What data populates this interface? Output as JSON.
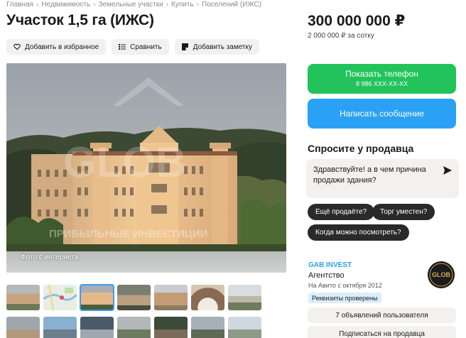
{
  "breadcrumbs": [
    "Главная",
    "Недвижимость",
    "Земельные участки",
    "Купить",
    "Поселений (ИЖС)"
  ],
  "listing": {
    "title": "Участок 1,5 га (ИЖС)",
    "price": "300 000 000 ₽",
    "price_per_unit": "2 000 000 ₽ за сотку"
  },
  "actions": {
    "favorite": "Добавить в избранное",
    "compare": "Сравнить",
    "note": "Добавить заметку"
  },
  "gallery": {
    "caption": "Фото с интернета",
    "watermark_line": "ПРИБЫЛЬНЫЕ ИНВЕСТИЦИИ"
  },
  "contact": {
    "show_phone": "Показать телефон",
    "phone_masked": "8 986 XXX-XX-XX",
    "write_message": "Написать сообщение"
  },
  "ask_seller": {
    "title": "Спросите у продавца",
    "message": "Здравствуйте! а в чем причина продажи здания?",
    "quick_replies": [
      "Ещё продаёте?",
      "Торг уместен?",
      "Когда можно посмотреть?"
    ]
  },
  "seller": {
    "name": "GAB INVEST",
    "type": "Агентство",
    "since": "На Авито с октября 2012",
    "verified": "Реквизиты проверены",
    "avatar_text": "GLOB",
    "listings_button": "7 объявлений пользователя",
    "subscribe_button": "Подписаться на продавца"
  },
  "colors": {
    "green": "#22c35a",
    "blue": "#2aa1f5",
    "link": "#2aa1f5"
  }
}
